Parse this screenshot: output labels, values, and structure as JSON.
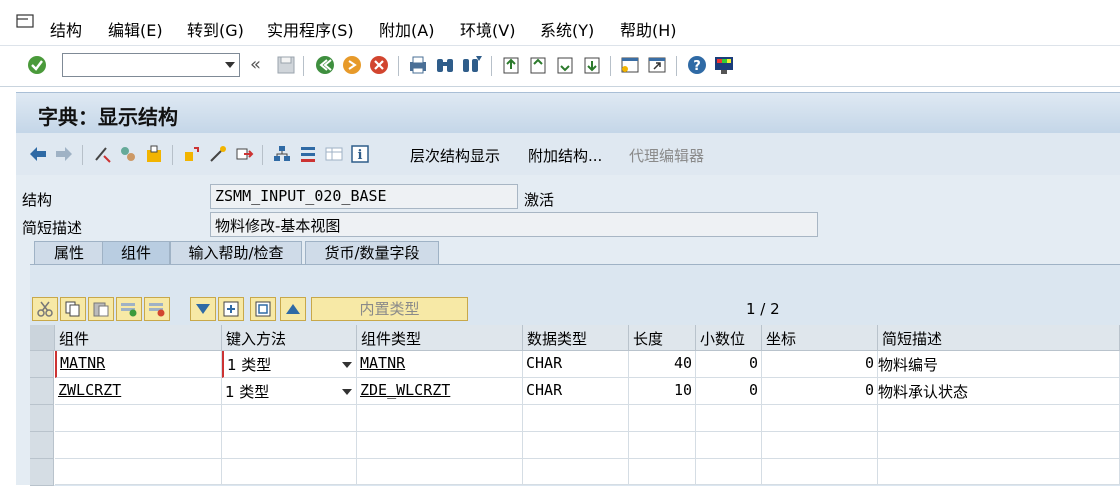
{
  "menu": [
    "结构",
    "编辑(E)",
    "转到(G)",
    "实用程序(S)",
    "附加(A)",
    "环境(V)",
    "系统(Y)",
    "帮助(H)"
  ],
  "system_toolbar": {
    "command_field_value": "",
    "icons": [
      "enter-icon",
      "back-double-arrow-icon",
      "save-icon",
      "back-icon",
      "exit-icon",
      "cancel-icon",
      "print-icon",
      "find-icon",
      "find-next-icon",
      "first-page-icon",
      "previous-page-icon",
      "next-page-icon",
      "last-page-icon",
      "new-session-icon",
      "shortcut-icon",
      "help-icon",
      "layout-icon"
    ]
  },
  "title": "字典：显示结构",
  "app_toolbar": {
    "buttons": [
      "层次结构显示",
      "附加结构...",
      "代理编辑器"
    ]
  },
  "header_fields": {
    "structure_label": "结构",
    "structure_value": "ZSMM_INPUT_020_BASE",
    "status": "激活",
    "short_desc_label": "简短描述",
    "short_desc_value": "物料修改-基本视图"
  },
  "tabs": [
    "属性",
    "组件",
    "输入帮助/检查",
    "货币/数量字段"
  ],
  "active_tab": "组件",
  "table_toolbar": {
    "builtin_type_label": "内置类型",
    "page_info": "1 / 2"
  },
  "table": {
    "columns": [
      "组件",
      "键入方法",
      "组件类型",
      "数据类型",
      "长度",
      "小数位",
      "坐标",
      "简短描述"
    ],
    "rows": [
      {
        "component": "MATNR",
        "typing_method": "1 类型",
        "component_type": "MATNR",
        "data_type": "CHAR",
        "length": "40",
        "decimals": "0",
        "coordinate": "0",
        "short_desc": "物料编号"
      },
      {
        "component": "ZWLCRZT",
        "typing_method": "1 类型",
        "component_type": "ZDE_WLCRZT",
        "data_type": "CHAR",
        "length": "10",
        "decimals": "0",
        "coordinate": "0",
        "short_desc": "物料承认状态"
      }
    ]
  }
}
